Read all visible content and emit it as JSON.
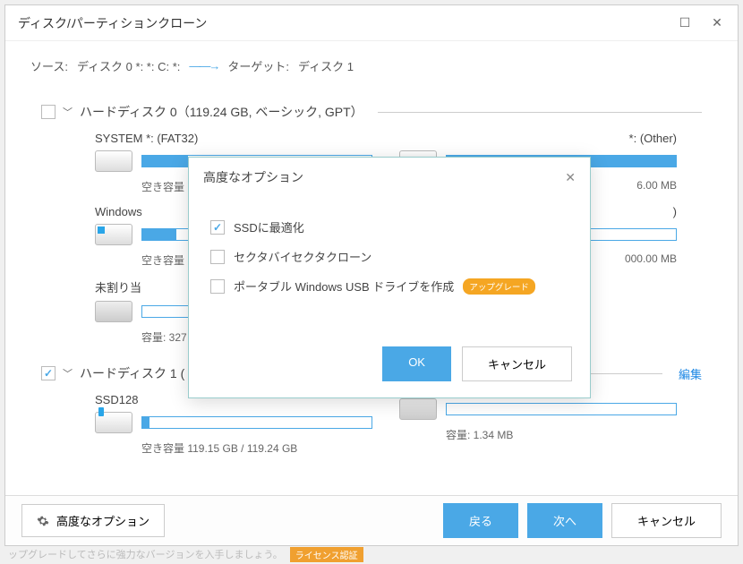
{
  "window": {
    "title": "ディスク/パーティションクローン"
  },
  "source": {
    "label": "ソース:",
    "value": "ディスク 0 *: *: C: *:",
    "target_label": "ターゲット:",
    "target_value": "ディスク 1"
  },
  "disks": [
    {
      "checked": false,
      "header": "ハードディスク 0（119.24 GB, ベーシック, GPT）",
      "partitions": [
        {
          "title": "SYSTEM *: (FAT32)",
          "sub": "空き容量",
          "fill": 20
        },
        {
          "title": "*: (Other)",
          "sub": "6.00 MB",
          "sub_prefix": "",
          "fill": 100
        },
        {
          "title": "Windows",
          "sub": "空き容量",
          "fill": 15,
          "icon": "win"
        },
        {
          "title": ")",
          "sub": "000.00 MB",
          "sub_prefix": "",
          "fill": 60
        },
        {
          "title": "未割り当",
          "sub": "容量: 327",
          "fill": 0,
          "icon": "gray"
        }
      ]
    },
    {
      "checked": true,
      "header": "ハードディスク 1 (",
      "edit": "編集",
      "partitions": [
        {
          "title": "SSD128",
          "sub": "空き容量 119.15 GB / 119.24 GB",
          "fill": 3,
          "icon": "ssd"
        },
        {
          "title": "",
          "sub": "容量: 1.34 MB",
          "fill": 0,
          "icon": "gray"
        }
      ]
    }
  ],
  "footer": {
    "advanced": "高度なオプション",
    "back": "戻る",
    "next": "次へ",
    "cancel": "キャンセル"
  },
  "modal": {
    "title": "高度なオプション",
    "opts": [
      {
        "label": "SSDに最適化",
        "checked": true
      },
      {
        "label": "セクタバイセクタクローン",
        "checked": false
      },
      {
        "label": "ポータブル Windows USB ドライブを作成",
        "checked": false,
        "badge": "アップグレード"
      }
    ],
    "ok": "OK",
    "cancel": "キャンセル"
  },
  "strip": {
    "text": "ップグレードしてさらに強力なバージョンを入手しましょう。",
    "badge": "ライセンス認証"
  }
}
